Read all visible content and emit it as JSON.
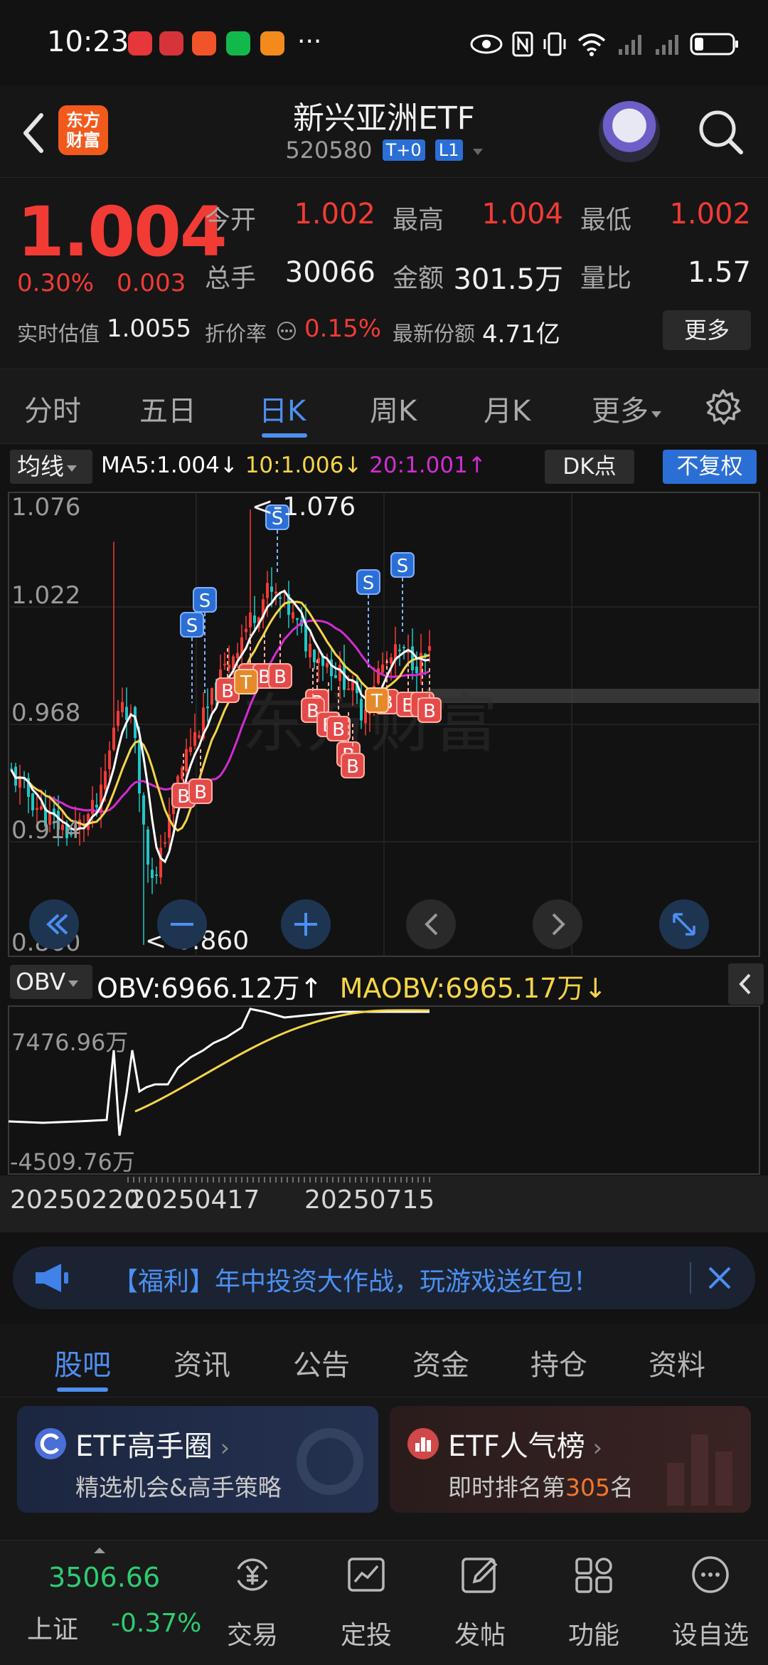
{
  "status_bar": {
    "time": "10:23",
    "more": "···"
  },
  "header": {
    "logo_line1": "东方",
    "logo_line2": "财富",
    "title": "新兴亚洲ETF",
    "code": "520580",
    "tag1": "T+0",
    "tag2": "L1"
  },
  "quote": {
    "price": "1.004",
    "change_pct": "0.30%",
    "change_val": "0.003",
    "open_label": "今开",
    "open": "1.002",
    "high_label": "最高",
    "high": "1.004",
    "low_label": "最低",
    "low": "1.002",
    "volume_label": "总手",
    "volume": "30066",
    "amount_label": "金额",
    "amount": "301.5万",
    "ratio_label": "量比",
    "ratio": "1.57",
    "iopv_label": "实时估值",
    "iopv": "1.0055",
    "premium_label": "折价率",
    "premium": "0.15%",
    "shares_label": "最新份额",
    "shares": "4.71亿",
    "more_label": "更多"
  },
  "period_tabs": [
    "分时",
    "五日",
    "日K",
    "周K",
    "月K",
    "更多"
  ],
  "ma_row": {
    "select": "均线",
    "ma5": "MA5:1.004↓",
    "ma10": "10:1.006↓",
    "ma20": "20:1.001↑",
    "dk": "DK点",
    "fq": "不复权"
  },
  "kline": {
    "y_top": "1.076",
    "y_2": "1.022",
    "y_3": "0.968",
    "y_4": "0.914",
    "y_bottom": "0.860",
    "max_label": "<-1.076",
    "min_label": "<-0.860",
    "watermark": "东方财富",
    "sell_marker": "S",
    "buy_marker": "B",
    "t_marker": "T"
  },
  "obv": {
    "select": "OBV",
    "obv": "OBV:6966.12万↑",
    "maobv": "MAOBV:6965.17万↓",
    "y_top": "7476.96万",
    "y_bottom": "-4509.76万"
  },
  "dates": [
    "20250220",
    "20250417",
    "20250715"
  ],
  "banner": {
    "text": "【福利】年中投资大作战，玩游戏送红包！"
  },
  "section_tabs": [
    "股吧",
    "资讯",
    "公告",
    "资金",
    "持仓",
    "资料"
  ],
  "cards": {
    "left_title": "ETF高手圈",
    "left_sub": "精选机会&高手策略",
    "right_title": "ETF人气榜",
    "right_sub_prefix": "即时排名第",
    "right_rank": "305",
    "right_sub_suffix": "名"
  },
  "bottom_nav": {
    "index_value": "3506.66",
    "index_name": "上证",
    "index_change": "-0.37%",
    "items": [
      "交易",
      "定投",
      "发帖",
      "功能",
      "设自选"
    ]
  },
  "colors": {
    "up": "#f23b35",
    "down": "#20c6c6",
    "accent": "#4d8ff0",
    "ma5": "#ffffff",
    "ma10": "#f5d547",
    "ma20": "#d22cd2"
  }
}
